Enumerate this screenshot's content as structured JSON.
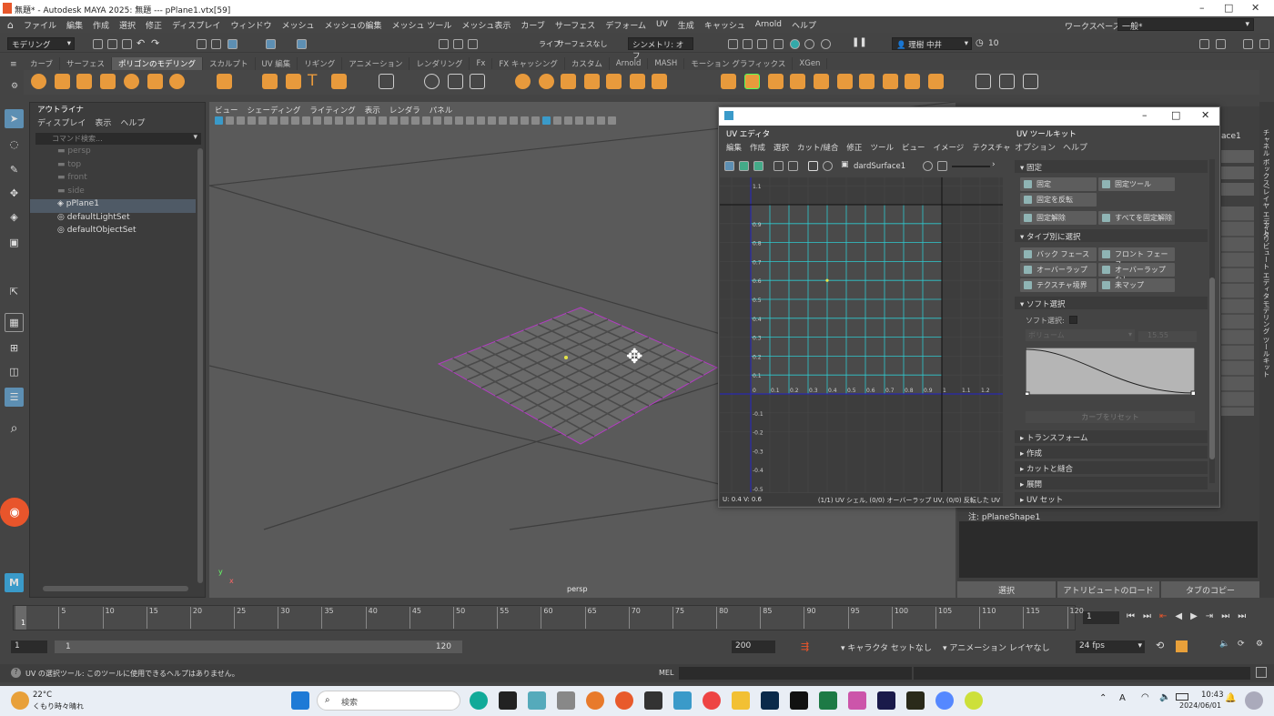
{
  "window": {
    "title": "無題* - Autodesk MAYA 2025: 無題 --- pPlane1.vtx[59]"
  },
  "menubar": [
    "ファイル",
    "編集",
    "作成",
    "選択",
    "修正",
    "ディスプレイ",
    "ウィンドウ",
    "メッシュ",
    "メッシュの編集",
    "メッシュ ツール",
    "メッシュ表示",
    "カーブ",
    "サーフェス",
    "デフォーム",
    "UV",
    "生成",
    "キャッシュ",
    "Arnold",
    "ヘルプ"
  ],
  "workspace": {
    "label": "ワークスペース :",
    "value": "一般*"
  },
  "statusline": {
    "mode": "モデリング",
    "live": "ライブ",
    "live_value": "サーフェスなし",
    "symmetry": "シンメトリ: オフ",
    "user": "理樹 中井",
    "count": "10"
  },
  "shelf_tabs": [
    "カーブ",
    "サーフェス",
    "ポリゴンのモデリング",
    "スカルプト",
    "UV 編集",
    "リギング",
    "アニメーション",
    "レンダリング",
    "Fx",
    "FX キャッシング",
    "カスタム",
    "Arnold",
    "MASH",
    "モーション グラフィックス",
    "XGen"
  ],
  "outliner": {
    "title": "アウトライナ",
    "menu": [
      "ディスプレイ",
      "表示",
      "ヘルプ"
    ],
    "search_placeholder": "コマンド検索...",
    "items": [
      "persp",
      "top",
      "front",
      "side",
      "pPlane1",
      "defaultLightSet",
      "defaultObjectSet"
    ]
  },
  "viewport": {
    "menu": [
      "ビュー",
      "シェーディング",
      "ライティング",
      "表示",
      "レンダラ",
      "パネル"
    ],
    "camera": "persp"
  },
  "uv_editor": {
    "title": "UV エディタ",
    "menu": [
      "編集",
      "作成",
      "選択",
      "カット/縫合",
      "修正",
      "ツール",
      "ビュー",
      "イメージ",
      "テクスチャ"
    ],
    "texture": "dardSurface1",
    "u_ticks": [
      "0.1",
      "0.2",
      "0.3",
      "0.4",
      "0.5",
      "0.6",
      "0.7",
      "0.8",
      "0.9",
      "1",
      "1.1",
      "1.2"
    ],
    "v_ticks": [
      "0.9",
      "0.8",
      "0.7",
      "0.6",
      "0.5",
      "0.4",
      "0.3",
      "0.2",
      "0.1"
    ],
    "neg_v_ticks": [
      "-0.1",
      "-0.2",
      "-0.3",
      "-0.4",
      "-0.5"
    ],
    "top_tick": "1.1",
    "origin": "0",
    "status_left": "U: 0.4 V: 0.6",
    "status_right": "(1/1) UV シェル, (0/0) オーバーラップ UV, (0/0) 反転した UV"
  },
  "uv_toolkit": {
    "title": "UV ツールキット",
    "menu": [
      "オプション",
      "ヘルプ"
    ],
    "pin_header": "固定",
    "pin": "固定",
    "pin_tool": "固定ツール",
    "invert_pin": "固定を反転",
    "unpin": "固定解除",
    "unpin_all": "すべてを固定解除",
    "type_header": "タイプ別に選択",
    "backface": "バック フェース",
    "frontface": "フロント フェース",
    "overlap": "オーバーラップ",
    "no_overlap": "オーバーラップなし",
    "texture_border": "テクスチャ境界",
    "unmapped": "未マップ",
    "soft_header": "ソフト選択",
    "soft_label": "ソフト選択:",
    "volume": "ボリューム",
    "volume_value": "15.55",
    "reset_curve": "カーブをリセット",
    "transform": "トランスフォーム",
    "create": "作成",
    "cut_sew": "カットと縫合",
    "unfold": "展開",
    "uv_sets": "UV セット"
  },
  "attr_editor": {
    "shape": "注: pPlaneShape1",
    "select": "選択",
    "load_attr": "アトリビュートのロード",
    "copy_tab": "タブのコピー",
    "side_tabs": [
      "チャネル ボックス/レイヤ エディタ",
      "アトリビュート エディタ",
      "モデリング ツールキット"
    ],
    "partial": "ace1"
  },
  "timeline": {
    "ticks": [
      "5",
      "10",
      "15",
      "20",
      "25",
      "30",
      "35",
      "40",
      "45",
      "50",
      "55",
      "60",
      "65",
      "70",
      "75",
      "80",
      "85",
      "90",
      "95",
      "100",
      "105",
      "110",
      "115",
      "120"
    ],
    "current": "1",
    "frame_field": "1"
  },
  "range": {
    "start": "1",
    "inner_start": "1",
    "inner_end": "120",
    "end": "200",
    "char_set": "キャラクタ セットなし",
    "anim_layer": "アニメーション レイヤなし",
    "fps": "24 fps"
  },
  "help": {
    "text": "UV の選択ツール: このツールに使用できるヘルプはありません。",
    "mel": "MEL"
  },
  "taskbar": {
    "temp": "22°C",
    "weather": "くもり時々晴れ",
    "search": "検索",
    "time": "10:43",
    "date": "2024/06/01"
  }
}
